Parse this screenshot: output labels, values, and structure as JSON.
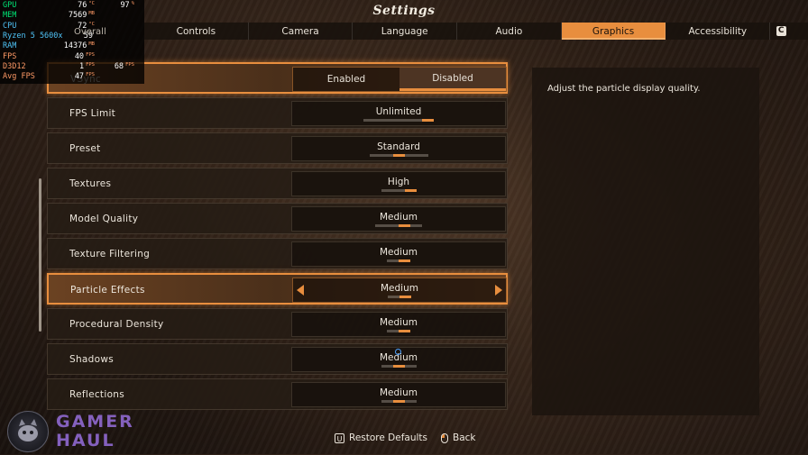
{
  "window": {
    "title": "Settings"
  },
  "tabs": [
    {
      "label": "Controls",
      "active": false
    },
    {
      "label": "Camera",
      "active": false
    },
    {
      "label": "Language",
      "active": false
    },
    {
      "label": "Audio",
      "active": false
    },
    {
      "label": "Graphics",
      "active": true
    },
    {
      "label": "Accessibility",
      "active": false
    }
  ],
  "tab_extra_key": "C",
  "settings": [
    {
      "label": "VSync",
      "type": "toggle",
      "options": [
        "Enabled",
        "Disabled"
      ],
      "selected": "Disabled"
    },
    {
      "label": "FPS Limit",
      "value": "Unlimited",
      "levels": 6,
      "level": 6
    },
    {
      "label": "Preset",
      "value": "Standard",
      "levels": 5,
      "level": 3
    },
    {
      "label": "Textures",
      "value": "High",
      "levels": 3,
      "level": 3
    },
    {
      "label": "Model Quality",
      "value": "Medium",
      "levels": 4,
      "level": 3
    },
    {
      "label": "Texture Filtering",
      "value": "Medium",
      "levels": 2,
      "level": 2
    },
    {
      "label": "Particle Effects",
      "value": "Medium",
      "levels": 2,
      "level": 2,
      "selected": true
    },
    {
      "label": "Procedural Density",
      "value": "Medium",
      "levels": 2,
      "level": 2
    },
    {
      "label": "Shadows",
      "value": "Medium",
      "levels": 3,
      "level": 2
    },
    {
      "label": "Reflections",
      "value": "Medium",
      "levels": 3,
      "level": 2
    }
  ],
  "description": "Adjust the particle display quality.",
  "footer": {
    "restore": {
      "key": "U",
      "label": "Restore Defaults"
    },
    "back": {
      "label": "Back"
    }
  },
  "overlay": {
    "rows": [
      {
        "label": "GPU",
        "v1": "76",
        "u1": "°C",
        "v2": "97",
        "u2": "%"
      },
      {
        "label": "MEM",
        "v1": "7569",
        "u1": "MB"
      },
      {
        "label": "CPU",
        "v1": "72",
        "u1": "°C"
      },
      {
        "label": "Ryzen 5 5600x",
        "v1": "59",
        "u1": ""
      },
      {
        "label": "RAM",
        "v1": "14376",
        "u1": "MB"
      },
      {
        "label": "FPS",
        "v1": "40",
        "u1": "FPS"
      },
      {
        "label": "D3D12",
        "v1": "1",
        "u1": "FPS",
        "v2": "68",
        "u2": "FPS"
      },
      {
        "label": "Avg FPS",
        "v1": "47",
        "u1": "FPS"
      }
    ],
    "colors": {
      "gpu": "#00e676",
      "cpu": "#4fc3f7",
      "ram": "#4fc3f7",
      "fps": "#ff9a66",
      "d3d": "#ff9a66",
      "label": "#ff9a66"
    }
  },
  "overlay_partial": "Overall",
  "watermark": {
    "line1": "GAMER",
    "line2": "HAUL"
  },
  "colors": {
    "accent": "#e88e3e"
  }
}
